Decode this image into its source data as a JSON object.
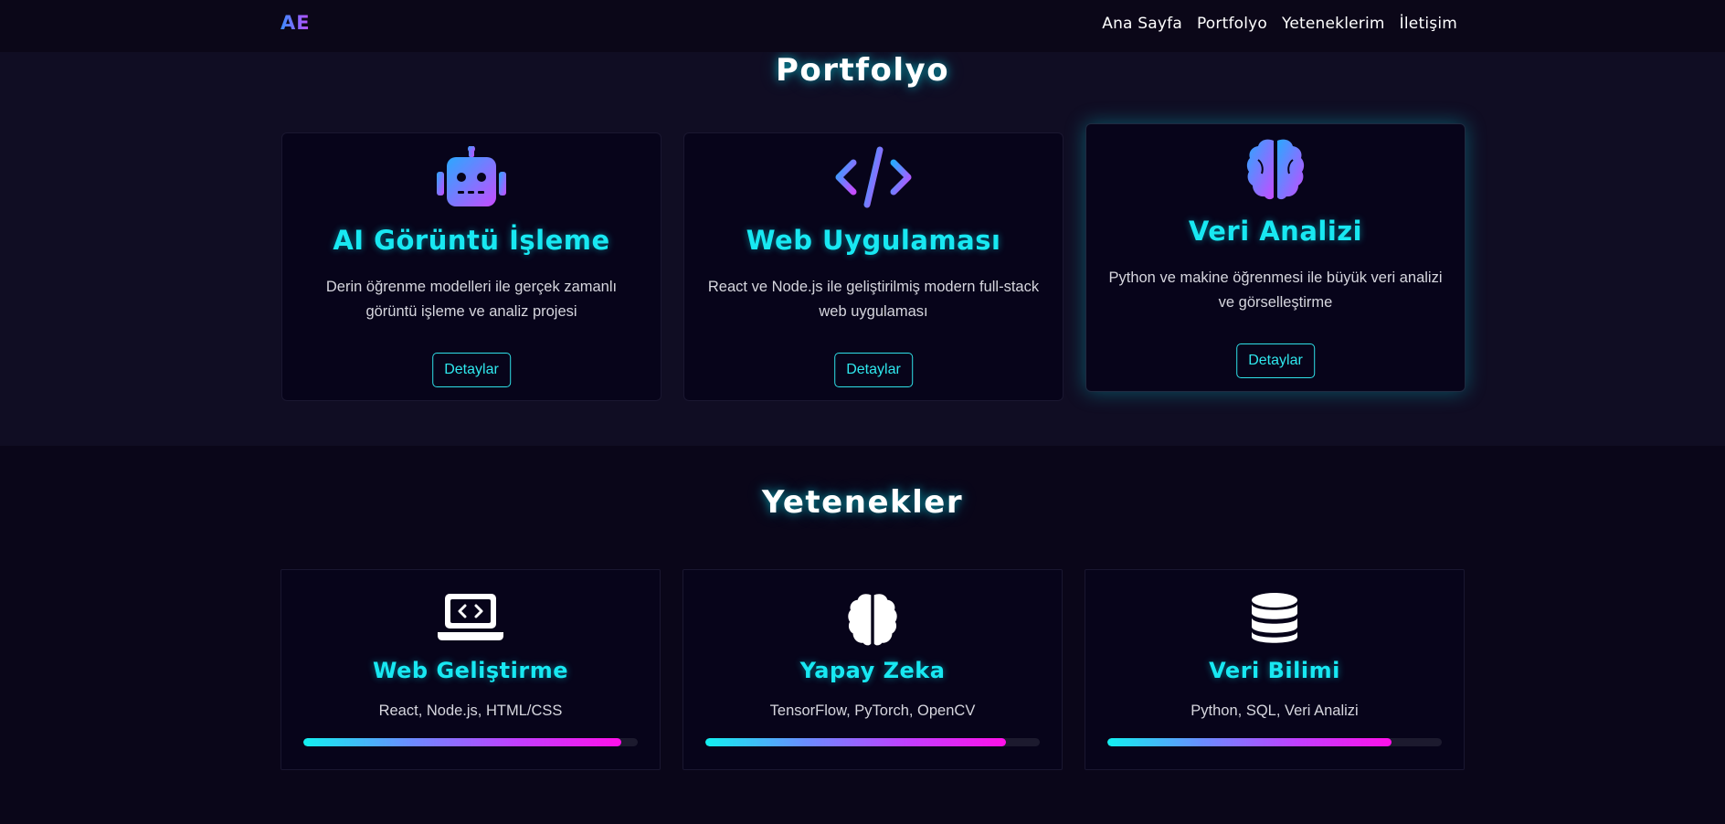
{
  "nav": {
    "logo": "AE",
    "links": [
      "Ana Sayfa",
      "Portfolyo",
      "Yeteneklerim",
      "İletişim"
    ]
  },
  "portfolio": {
    "title": "Portfolyo",
    "cards": [
      {
        "icon": "robot-icon",
        "title": "AI Görüntü İşleme",
        "description": "Derin öğrenme modelleri ile gerçek zamanlı görüntü işleme ve analiz projesi",
        "button": "Detaylar"
      },
      {
        "icon": "code-icon",
        "title": "Web Uygulaması",
        "description": "React ve Node.js ile geliştirilmiş modern full-stack web uygulaması",
        "button": "Detaylar"
      },
      {
        "icon": "brain-icon",
        "title": "Veri Analizi",
        "description": "Python ve makine öğrenmesi ile büyük veri analizi ve görselleştirme",
        "button": "Detaylar"
      }
    ]
  },
  "skills": {
    "title": "Yetenekler",
    "cards": [
      {
        "icon": "laptop-code-icon",
        "title": "Web Geliştirme",
        "description": "React, Node.js, HTML/CSS",
        "level": 0.95
      },
      {
        "icon": "brain-icon",
        "title": "Yapay Zeka",
        "description": "TensorFlow, PyTorch, OpenCV",
        "level": 0.9
      },
      {
        "icon": "database-icon",
        "title": "Veri Bilimi",
        "description": "Python, SQL, Veri Analizi",
        "level": 0.85
      }
    ]
  },
  "colors": {
    "accent": "#18e8f2",
    "gradient_start": "#12f0f0",
    "gradient_end": "#ff10e8",
    "background": "#0a0619"
  }
}
